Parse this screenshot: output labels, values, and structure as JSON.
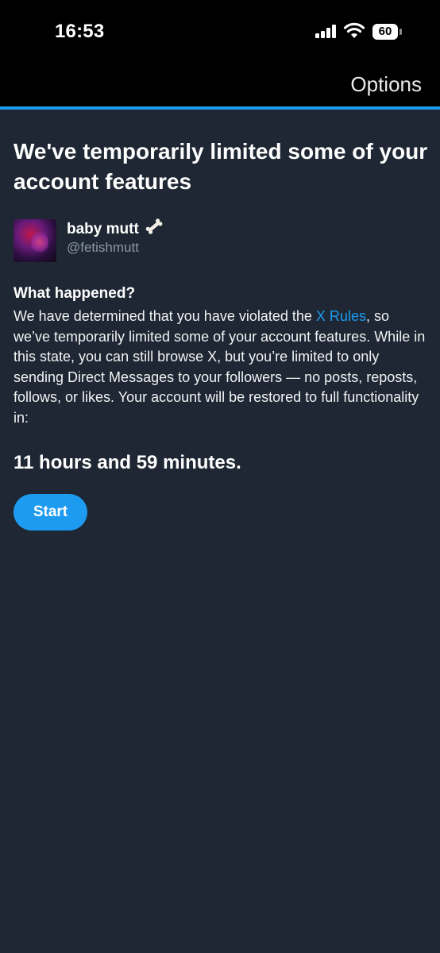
{
  "status_bar": {
    "time": "16:53",
    "battery_level": "60",
    "signal_icon": "cellular-signal-icon",
    "wifi_icon": "wifi-icon"
  },
  "nav": {
    "options_label": "Options"
  },
  "colors": {
    "accent": "#1d9bf0",
    "background": "#1e2733",
    "muted_text": "#8b98a5"
  },
  "page": {
    "title": "We've temporarily limited some of your account features"
  },
  "profile": {
    "display_name": "baby mutt",
    "name_emoji_icon": "bone-icon",
    "handle": "@fetishmutt"
  },
  "what_happened": {
    "heading": "What happened?",
    "text_before_link": "We have determined that you have violated the ",
    "link_label": "X Rules",
    "text_after_link": ", so we’ve temporarily limited some of your account features. While in this state, you can still browse X, but you’re limited to only sending Direct Messages to your followers — no posts, reposts, follows, or likes. Your account will be restored to full functionality in:"
  },
  "countdown": {
    "text": "11 hours and 59 minutes."
  },
  "actions": {
    "start_label": "Start"
  }
}
